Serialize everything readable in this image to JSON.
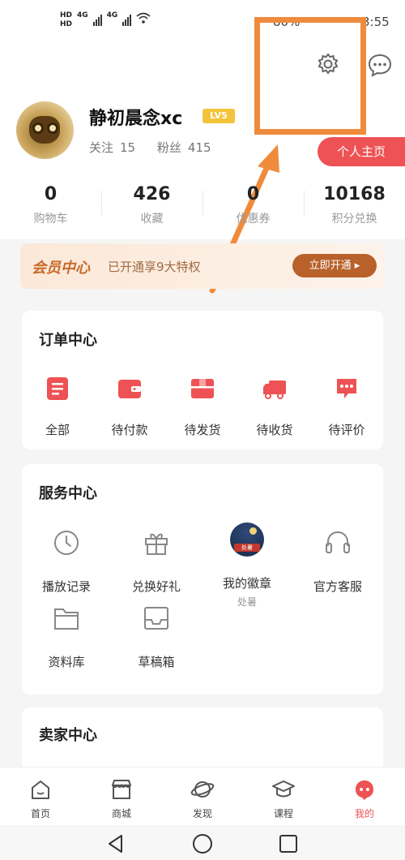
{
  "status_bar": {
    "hd1": "HD",
    "hd2": "HD",
    "net1": "4G",
    "net2": "4G",
    "battery": "80%",
    "time": "3:55"
  },
  "profile": {
    "username": "静初晨念xc",
    "level": "LV5",
    "follow_label": "关注",
    "follow_count": "15",
    "fans_label": "粉丝",
    "fans_count": "415",
    "homepage_button": "个人主页"
  },
  "stats": [
    {
      "value": "0",
      "label": "购物车"
    },
    {
      "value": "426",
      "label": "收藏"
    },
    {
      "value": "0",
      "label": "优惠券"
    },
    {
      "value": "10168",
      "label": "积分兑换"
    }
  ],
  "vip": {
    "title": "会员中心",
    "desc": "已开通享9大特权",
    "button": "立即开通 ▸"
  },
  "order_center": {
    "title": "订单中心",
    "items": [
      {
        "label": "全部",
        "icon": "list-icon"
      },
      {
        "label": "待付款",
        "icon": "wallet-icon"
      },
      {
        "label": "待发货",
        "icon": "box-icon"
      },
      {
        "label": "待收货",
        "icon": "truck-icon"
      },
      {
        "label": "待评价",
        "icon": "comment-icon"
      }
    ]
  },
  "service_center": {
    "title": "服务中心",
    "items": [
      {
        "label": "播放记录",
        "icon": "clock-icon"
      },
      {
        "label": "兑换好礼",
        "icon": "gift-icon"
      },
      {
        "label": "我的徽章",
        "icon": "badge-icon",
        "sub": "处暑"
      },
      {
        "label": "官方客服",
        "icon": "headset-icon"
      },
      {
        "label": "资料库",
        "icon": "folder-icon"
      },
      {
        "label": "草稿箱",
        "icon": "inbox-icon"
      }
    ],
    "badge_tag": "处暑"
  },
  "seller_center": {
    "title": "卖家中心"
  },
  "tabbar": [
    {
      "label": "首页",
      "icon": "home-icon"
    },
    {
      "label": "商城",
      "icon": "shop-icon"
    },
    {
      "label": "发现",
      "icon": "planet-icon"
    },
    {
      "label": "课程",
      "icon": "graduation-cap-icon"
    },
    {
      "label": "我的",
      "icon": "profile-icon",
      "active": true
    }
  ],
  "colors": {
    "accent": "#ee5254",
    "annotation": "#f08b3c",
    "vip_button": "#b8612a"
  }
}
